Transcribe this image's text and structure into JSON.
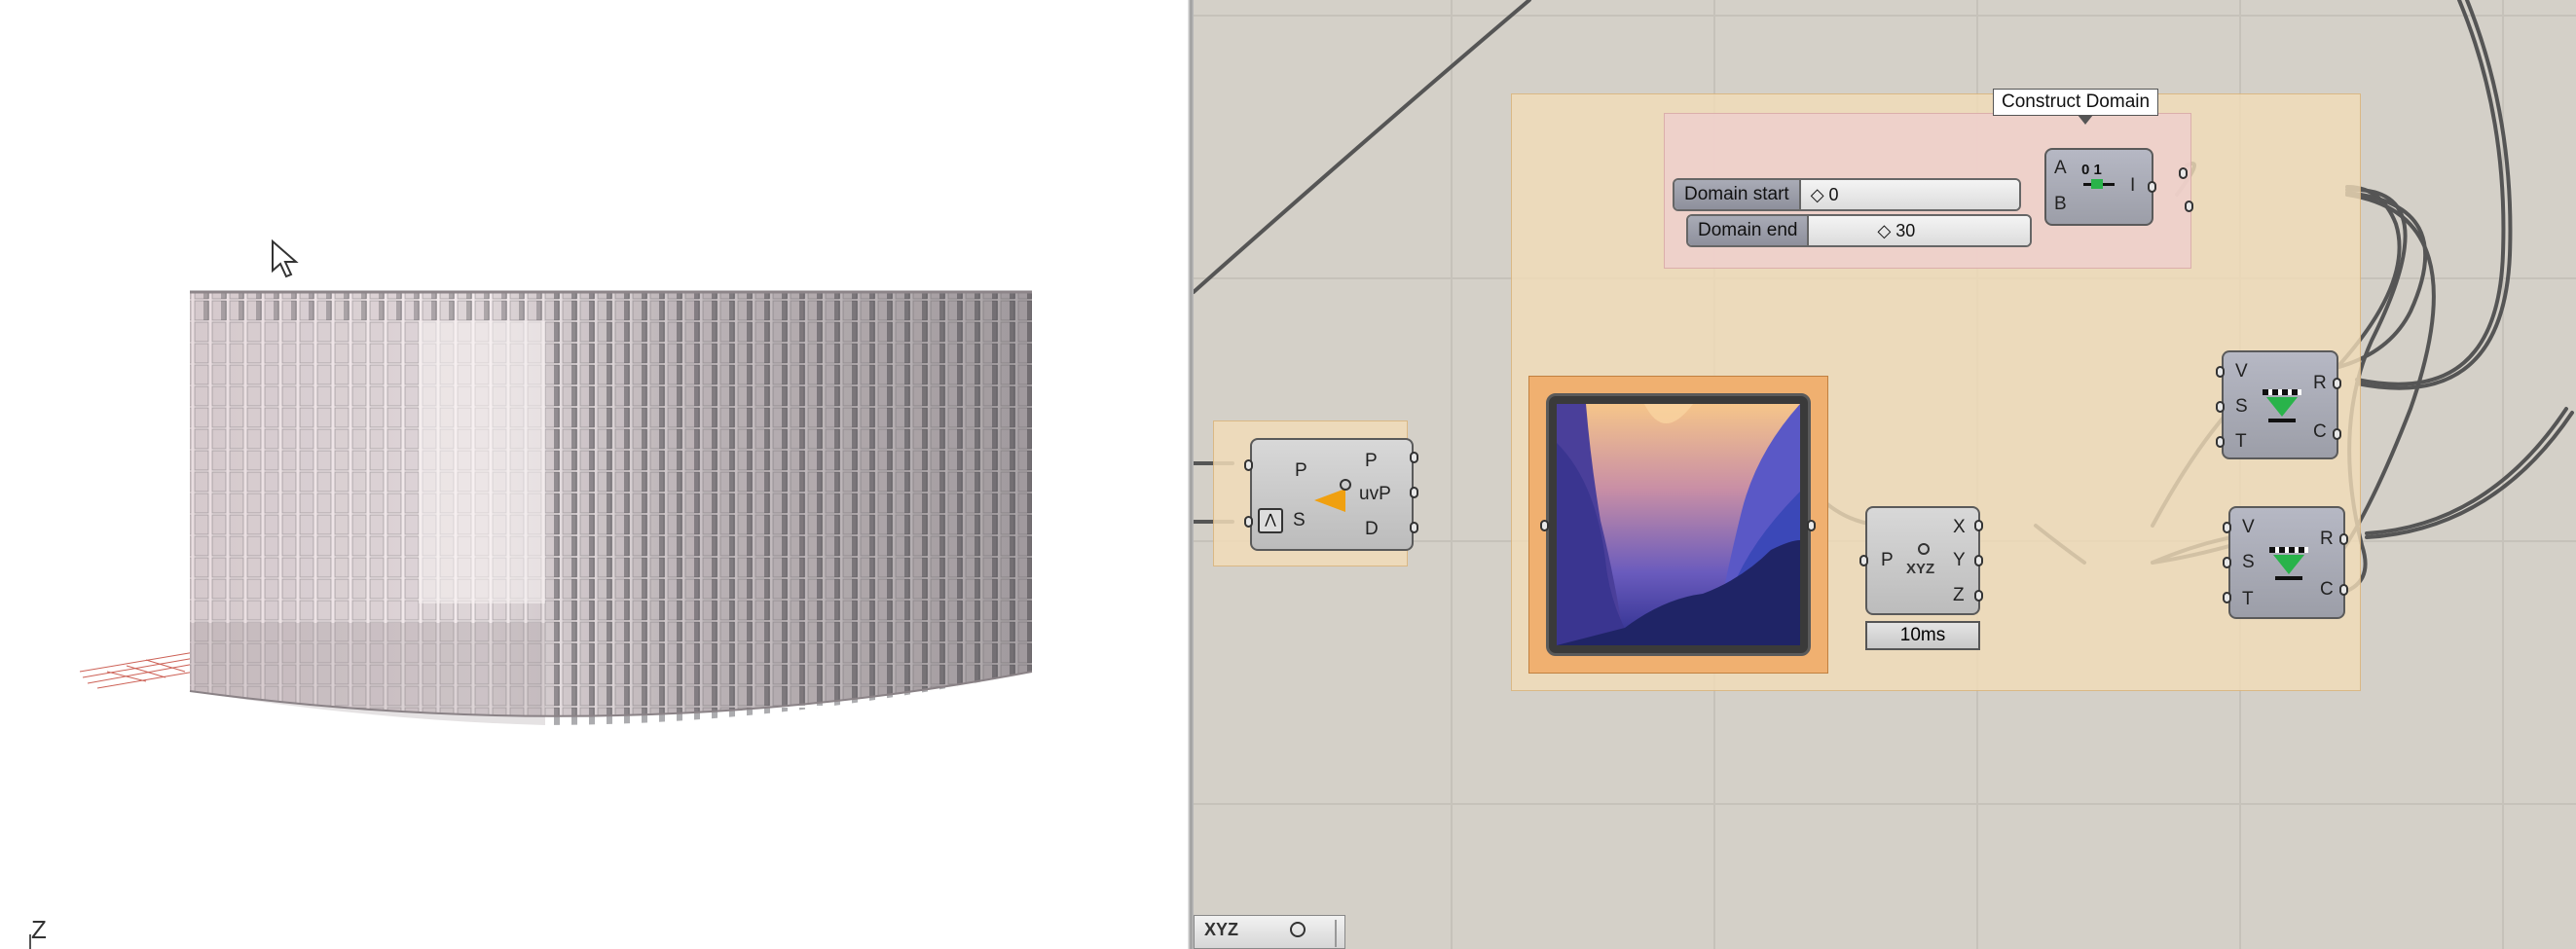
{
  "viewport": {
    "axis_label": "Z"
  },
  "canvas": {
    "tooltip": "Construct Domain",
    "sliders": [
      {
        "label": "Domain start",
        "value": "0"
      },
      {
        "label": "Domain end",
        "value": "30"
      }
    ],
    "construct_domain": {
      "inputs": [
        "A",
        "B"
      ],
      "output": "I",
      "icon_text": "0 1"
    },
    "surface_closest_point": {
      "inputs": [
        "P",
        "S"
      ],
      "outputs": [
        "P",
        "uvP",
        "D"
      ]
    },
    "deconstruct_point": {
      "input": "P",
      "outputs": [
        "X",
        "Y",
        "Z"
      ],
      "icon_text": "XYZ",
      "timing": "10ms"
    },
    "remap_1": {
      "inputs": [
        "V",
        "S",
        "T"
      ],
      "outputs": [
        "R",
        "C"
      ]
    },
    "remap_2": {
      "inputs": [
        "V",
        "S",
        "T"
      ],
      "outputs": [
        "R",
        "C"
      ]
    },
    "toolbar_text": "XYZ"
  },
  "colors": {
    "group_orange": "#f1dcb8",
    "group_pink": "#efcfcc",
    "canvas_bg": "#d4d0c8",
    "panel_highlight": "#f0b070"
  }
}
